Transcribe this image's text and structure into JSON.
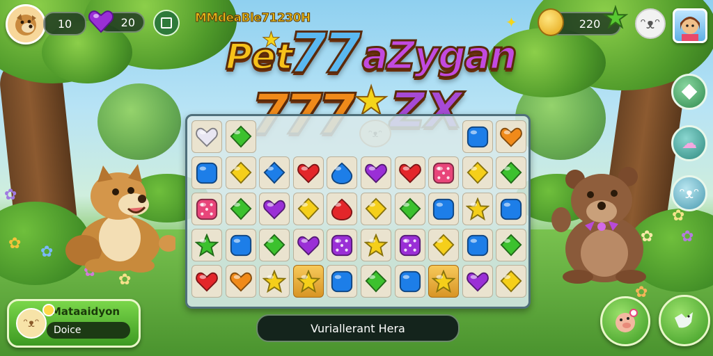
{
  "hud": {
    "lives": "10",
    "gems": "20",
    "event_label": "MMdeaBle71230H",
    "coins": "220"
  },
  "title": {
    "line1_a": "Pet",
    "line1_b": "77",
    "line1_c": "aZygan",
    "line2_a": "777",
    "line2_b": "ZX"
  },
  "board": {
    "rows": [
      [
        "heart-white",
        "diamond-green",
        "",
        "",
        "",
        "",
        "",
        "",
        "square-blue",
        "heart-orange"
      ],
      [
        "square-blue",
        "diamond-yellow",
        "diamond-blue",
        "heart-red",
        "drop-blue",
        "heart-purple",
        "heart-red",
        "dice-pink",
        "diamond-yellow",
        "diamond-green"
      ],
      [
        "dice-pink",
        "diamond-green",
        "heart-purple",
        "diamond-yellow",
        "drop-red",
        "diamond-yellow",
        "diamond-green",
        "square-blue",
        "star-yellow",
        "square-blue"
      ],
      [
        "star-green",
        "square-blue",
        "diamond-green",
        "heart-purple",
        "dice-purple",
        "star-yellow",
        "dice-purple",
        "diamond-yellow",
        "square-blue",
        "diamond-green"
      ],
      [
        "heart-red",
        "heart-orange",
        "star-yellow",
        "star-gold",
        "square-blue",
        "diamond-green",
        "square-blue",
        "star-gold",
        "heart-purple",
        "diamond-yellow"
      ]
    ]
  },
  "player": {
    "name": "Mataaidyon",
    "status": "Doice"
  },
  "message": "Vuriallerant Hera",
  "colors": {
    "red": "#e3262a",
    "orange": "#f08a1a",
    "yellow": "#f5cf1a",
    "green": "#3cc12e",
    "blue": "#1d7ee8",
    "purple": "#9a2fd6",
    "pink": "#e8457a",
    "white": "#e8e6f2"
  }
}
